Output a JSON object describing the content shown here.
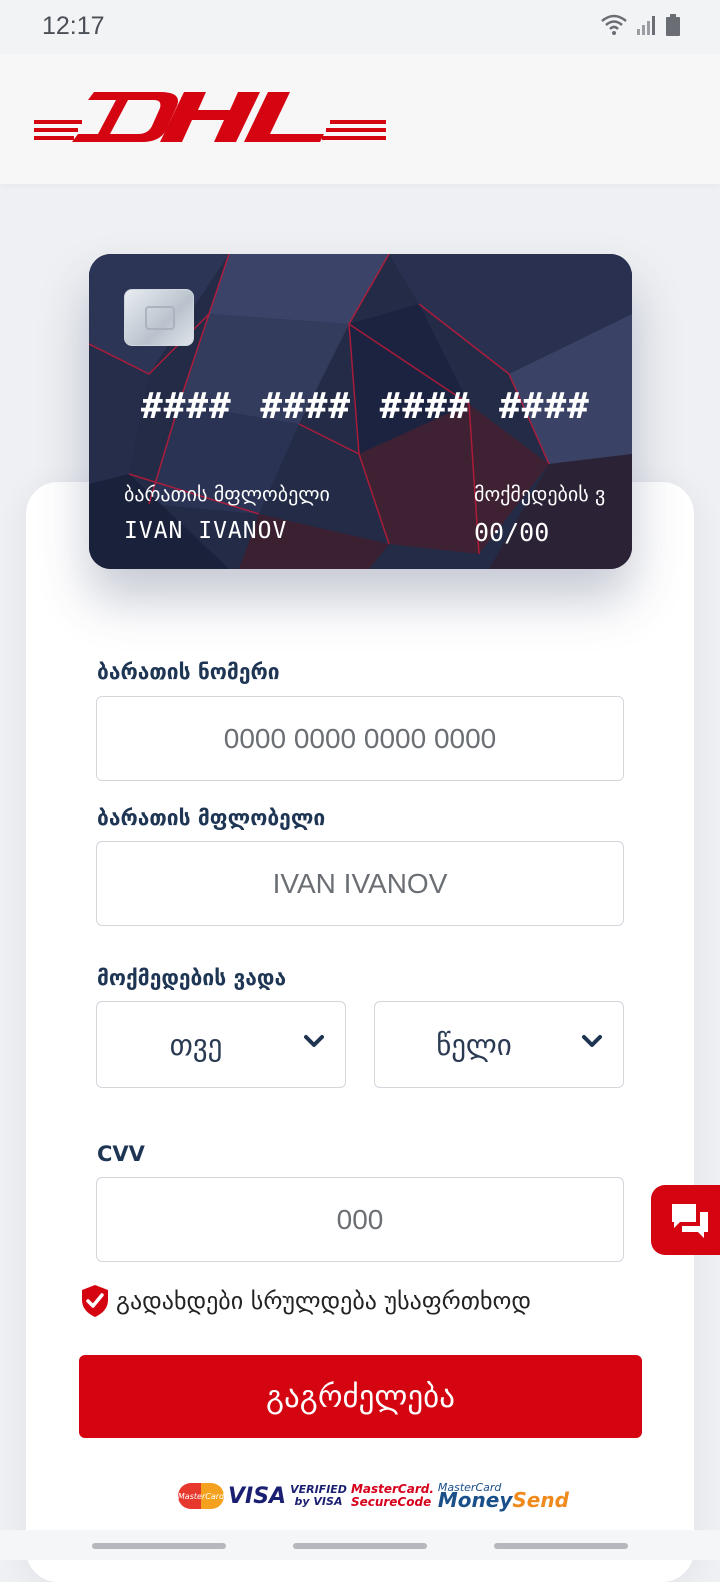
{
  "status_bar": {
    "time": "12:17"
  },
  "brand": {
    "name": "DHL",
    "color": "#d40511"
  },
  "card_preview": {
    "number": "#### #### #### ####",
    "holder_label": "ბარათის მფლობელი",
    "holder_value": "IVAN IVANOV",
    "expiry_label": "მოქმედების ვ",
    "expiry_value": "00/00"
  },
  "form": {
    "card_number": {
      "label": "ბარათის ნომერი",
      "placeholder": "0000 0000 0000 0000"
    },
    "card_holder": {
      "label": "ბარათის მფლობელი",
      "placeholder": "IVAN IVANOV"
    },
    "expiry": {
      "label": "მოქმედების ვადა",
      "month_value": "თვე",
      "year_value": "წელი"
    },
    "cvv": {
      "label": "CVV",
      "placeholder": "000"
    },
    "secure_note": "გადახდები სრულდება უსაფრთხოდ",
    "submit_label": "გაგრძელება"
  },
  "payment_logos": {
    "mastercard": "MasterCard",
    "visa": "VISA",
    "verified_by_visa_line1": "VERIFIED",
    "verified_by_visa_line2": "by VISA",
    "mc_securecode_line1": "MasterCard.",
    "mc_securecode_line2": "SecureCode",
    "mc_moneysend_line1": "MasterCard",
    "mc_moneysend_money": "Money",
    "mc_moneysend_send": "Send"
  },
  "icons": {
    "wifi": "wifi-icon",
    "signal": "signal-icon",
    "battery": "battery-icon",
    "chevron": "chevron-down-icon",
    "shield": "shield-check-icon",
    "chat": "chat-icon"
  }
}
